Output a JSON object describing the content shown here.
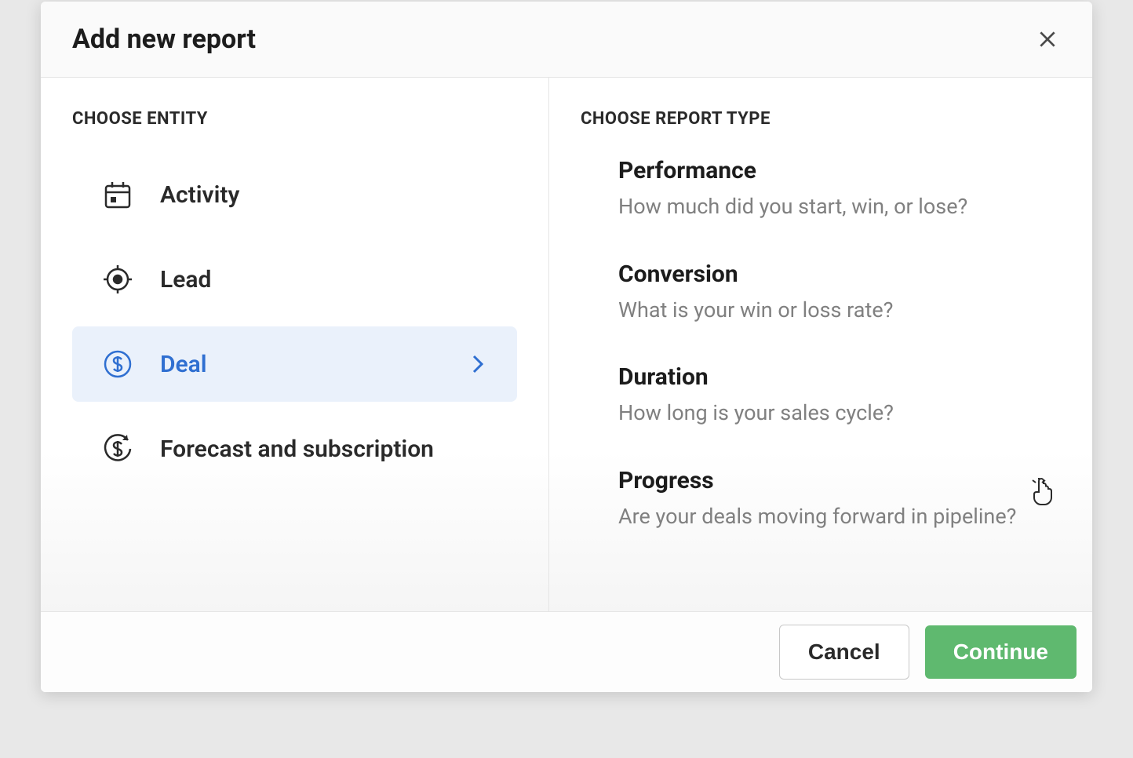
{
  "modal": {
    "title": "Add new report"
  },
  "left": {
    "heading": "CHOOSE ENTITY",
    "entities": [
      {
        "label": "Activity",
        "icon": "calendar-icon",
        "selected": false
      },
      {
        "label": "Lead",
        "icon": "target-icon",
        "selected": false
      },
      {
        "label": "Deal",
        "icon": "dollar-circle-icon",
        "selected": true
      },
      {
        "label": "Forecast and subscription",
        "icon": "dollar-refresh-icon",
        "selected": false
      }
    ]
  },
  "right": {
    "heading": "CHOOSE REPORT TYPE",
    "types": [
      {
        "title": "Performance",
        "desc": "How much did you start, win, or lose?"
      },
      {
        "title": "Conversion",
        "desc": "What is your win or loss rate?"
      },
      {
        "title": "Duration",
        "desc": "How long is your sales cycle?"
      },
      {
        "title": "Progress",
        "desc": "Are your deals moving forward in pipeline?"
      }
    ]
  },
  "footer": {
    "cancel": "Cancel",
    "continue": "Continue"
  }
}
